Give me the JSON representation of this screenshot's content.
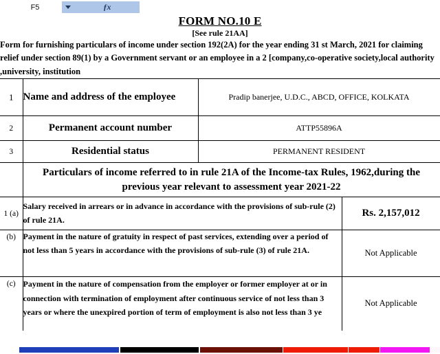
{
  "formula_bar": {
    "name_box_value": "F5",
    "dropdown_icon": "chevron-down-icon",
    "function_icon": "fx-icon",
    "formula_value": ""
  },
  "document": {
    "title": "FORM NO.10 E",
    "subtitle": "[See rule 21AA]",
    "intro": "Form for furnishing particulars of income under section 192(2A) for the year ending 31 st March, 2021 for claiming relief under section 89(1) by a Government servant or an employee in a 2 [company,co-operative society,local authority ,university, institution",
    "info_rows": [
      {
        "num": "1",
        "label": "Name and address of the employee",
        "value": "Pradip banerjee, U.D.C.,  ABCD, OFFICE, KOLKATA"
      },
      {
        "num": "2",
        "label": "Permanent account number",
        "value": "ATTP55896A"
      },
      {
        "num": "3",
        "label": "Residential status",
        "value": "PERMANENT RESIDENT"
      }
    ],
    "particulars_heading": "Particulars of income referred to in rule 21A of the Income-tax Rules, 1962,during the previous year relevant to assessment year 2021-22",
    "particulars_rows": [
      {
        "num": "1 (a)",
        "description": "Salary received in arrears or in advance in accordance with the provisions of sub-rule (2) of rule 21A.",
        "value": "Rs. 2,157,012"
      },
      {
        "num": "(b)",
        "description": "Payment in the nature of gratuity in respect of past services, extending over a period of not less than 5 years in accordance with the provisions of sub-rule (3) of rule 21A.",
        "value": "Not Applicable"
      },
      {
        "num": "(c)",
        "description": "Payment in the nature of compensation from the employer or former employer at or in connection with termination of employment after continuous service of not less than 3 years or where the unexpired portion of term of employment is also not less than 3 ye",
        "value": "Not Applicable"
      }
    ]
  },
  "colors": {
    "name_box_highlight": "#aec6e8",
    "strip_blue": "#1f3fb8",
    "strip_black": "#000000",
    "strip_dark_red": "#6b1005",
    "strip_red": "#ee1c07",
    "strip_magenta": "#f318f3",
    "strip_white": "#fdf6fb"
  }
}
